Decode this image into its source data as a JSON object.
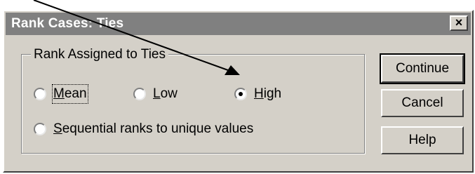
{
  "window": {
    "title": "Rank Cases: Ties",
    "close_glyph": "×"
  },
  "group": {
    "legend": "Rank Assigned to Ties"
  },
  "options": {
    "mean": {
      "label_underlined": "M",
      "label_rest": "ean",
      "selected": false
    },
    "low": {
      "label_underlined": "L",
      "label_rest": "ow",
      "selected": false
    },
    "high": {
      "label_underlined": "H",
      "label_rest": "igh",
      "selected": true
    },
    "sequential": {
      "label_underlined": "S",
      "label_rest": "equential ranks to unique values",
      "selected": false
    }
  },
  "buttons": {
    "continue": "Continue",
    "cancel": "Cancel",
    "help": "Help"
  },
  "annotation": {
    "arrow_color": "#000000"
  }
}
